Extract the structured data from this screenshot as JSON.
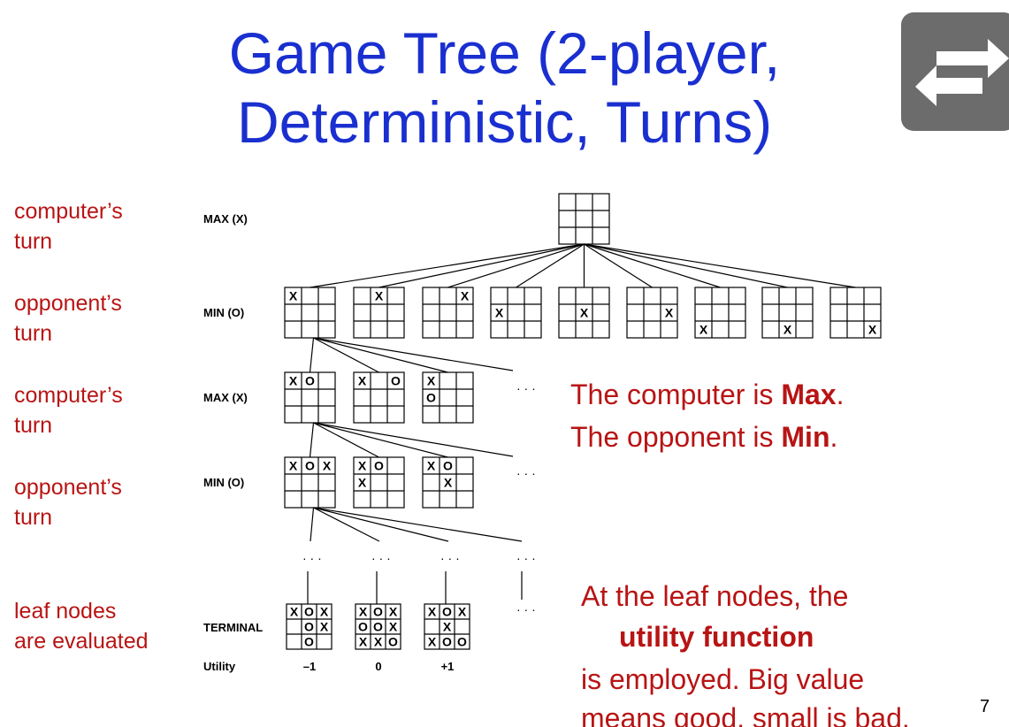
{
  "slide": {
    "title_line1": "Game Tree (2-player,",
    "title_line2": "Deterministic, Turns)",
    "number": "7"
  },
  "toolbar": {
    "swap_icon": "swap-arrows-icon"
  },
  "side_labels": {
    "computer_turn_1": [
      "computer’s",
      "turn"
    ],
    "opponent_turn_1": [
      "opponent’s",
      "turn"
    ],
    "computer_turn_2": [
      "computer’s",
      "turn"
    ],
    "opponent_turn_2": [
      "opponent’s",
      "turn"
    ],
    "leaf": [
      "leaf nodes",
      "are evaluated"
    ]
  },
  "levels": {
    "max1": "MAX (X)",
    "min1": "MIN (O)",
    "max2": "MAX (X)",
    "min2": "MIN (O)",
    "terminal": "TERMINAL",
    "utility": "Utility"
  },
  "utilities": [
    "–1",
    "0",
    "+1"
  ],
  "ellipsis": "· · ·",
  "boards": {
    "root": [
      "",
      "",
      "",
      "",
      "",
      "",
      "",
      "",
      ""
    ],
    "min1": [
      [
        "X",
        "",
        "",
        "",
        "",
        "",
        "",
        "",
        ""
      ],
      [
        "",
        "X",
        "",
        "",
        "",
        "",
        "",
        "",
        ""
      ],
      [
        "",
        "",
        "X",
        "",
        "",
        "",
        "",
        "",
        ""
      ],
      [
        "",
        "",
        "",
        "X",
        "",
        "",
        "",
        "",
        ""
      ],
      [
        "",
        "",
        "",
        "",
        "X",
        "",
        "",
        "",
        ""
      ],
      [
        "",
        "",
        "",
        "",
        "",
        "X",
        "",
        "",
        ""
      ],
      [
        "",
        "",
        "",
        "",
        "",
        "",
        "X",
        "",
        ""
      ],
      [
        "",
        "",
        "",
        "",
        "",
        "",
        "",
        "X",
        ""
      ],
      [
        "",
        "",
        "",
        "",
        "",
        "",
        "",
        "",
        "X"
      ]
    ],
    "max2": [
      [
        "X",
        "O",
        "",
        "",
        "",
        "",
        "",
        "",
        ""
      ],
      [
        "X",
        "",
        "O",
        "",
        "",
        "",
        "",
        "",
        ""
      ],
      [
        "X",
        "",
        "",
        "O",
        "",
        "",
        "",
        "",
        ""
      ]
    ],
    "min2": [
      [
        "X",
        "O",
        "X",
        "",
        "",
        "",
        "",
        "",
        ""
      ],
      [
        "X",
        "O",
        "",
        "X",
        "",
        "",
        "",
        "",
        ""
      ],
      [
        "X",
        "O",
        "",
        "",
        "X",
        "",
        "",
        "",
        ""
      ]
    ],
    "terminal": [
      [
        "X",
        "O",
        "X",
        "",
        "O",
        "X",
        "",
        "O",
        ""
      ],
      [
        "X",
        "O",
        "X",
        "O",
        "O",
        "X",
        "X",
        "X",
        "O"
      ],
      [
        "X",
        "O",
        "X",
        "",
        "X",
        "",
        "X",
        "O",
        "O"
      ]
    ]
  },
  "notes": {
    "max_line_pre": "The computer is ",
    "max_bold": "Max",
    "max_end": ".",
    "min_line_pre": "The opponent is ",
    "min_bold": "Min",
    "min_end": ".",
    "leaf_line1": "At the leaf nodes, the",
    "leaf_bold": "utility function",
    "leaf_line3": "is employed. Big value",
    "leaf_line4": "means good, small is bad."
  }
}
